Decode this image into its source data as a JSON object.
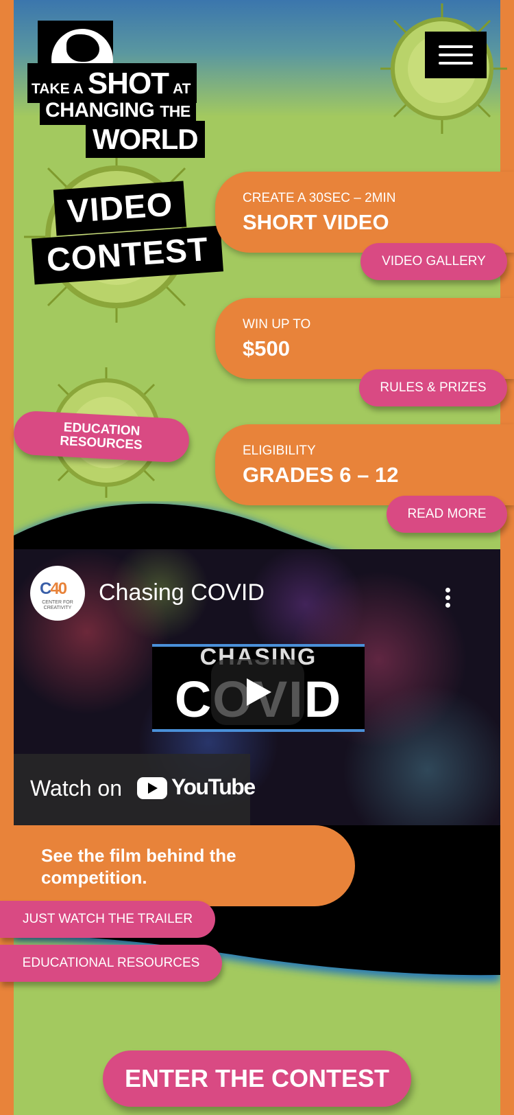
{
  "logo": {
    "line1_a": "TAKE A",
    "line1_b": "SHOT",
    "line1_c": "AT",
    "line2_a": "CHANGING",
    "line2_b": "THE",
    "line3": "WORLD"
  },
  "contest_badge": {
    "line1": "VIDEO",
    "line2": "CONTEST"
  },
  "cards": [
    {
      "small": "CREATE A 30SEC – 2MIN",
      "big": "SHORT VIDEO",
      "button": "VIDEO GALLERY"
    },
    {
      "small": "WIN UP TO",
      "big": "$500",
      "button": "RULES & PRIZES"
    },
    {
      "small": "ELIGIBILITY",
      "big": "GRADES 6 – 12",
      "button": "READ MORE"
    }
  ],
  "education_badge": {
    "line1": "EDUCATION",
    "line2": "RESOURCES"
  },
  "video": {
    "channel_mark": "C",
    "channel_mark_accent": "40",
    "channel_subtitle": "CENTER FOR CREATIVITY",
    "title": "Chasing COVID",
    "thumb_line1": "CHASING",
    "thumb_line2": "COVID",
    "watch_on": "Watch on",
    "youtube_word": "YouTube"
  },
  "film": {
    "text": "See the film behind the competition.",
    "trailer_button": "JUST WATCH THE TRAILER",
    "resources_button": "EDUCATIONAL RESOURCES"
  },
  "cta": {
    "enter_button": "ENTER THE CONTEST"
  },
  "colors": {
    "orange": "#e8833a",
    "pink": "#d94a83",
    "green": "#a3c95f",
    "blue": "#3b76ad",
    "black": "#000000"
  }
}
